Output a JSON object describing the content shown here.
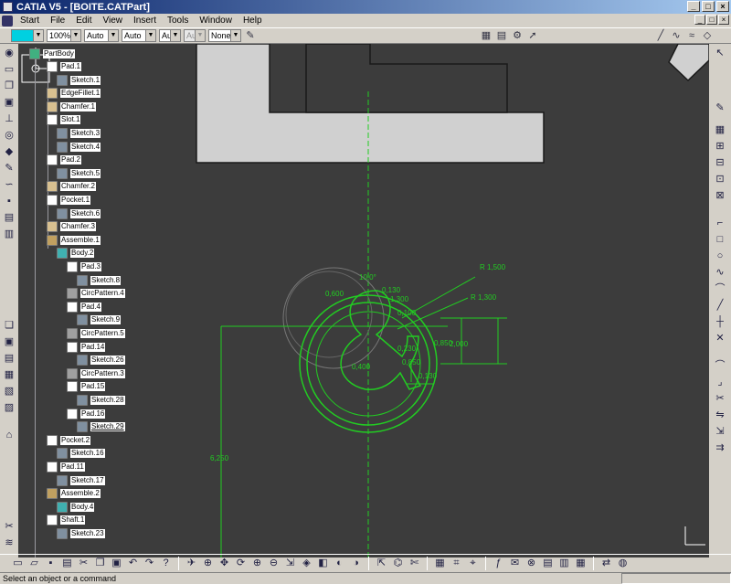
{
  "window": {
    "title": "CATIA V5 - [BOITE.CATPart]",
    "btn_min": "_",
    "btn_max": "□",
    "btn_close": "×"
  },
  "menu": {
    "items": [
      "Start",
      "File",
      "Edit",
      "View",
      "Insert",
      "Tools",
      "Window",
      "Help"
    ]
  },
  "toolbar": {
    "zoom_value": "100%",
    "line_combo_1": "Auto",
    "line_combo_2": "Auto",
    "line_combo_3": "Aut",
    "line_combo_4": "Aut",
    "layer_combo": "None"
  },
  "tree": {
    "root": "PartBody",
    "nodes": [
      {
        "label": "Pad.1",
        "level": 1,
        "icon": "pad-icon"
      },
      {
        "label": "Sketch.1",
        "level": 2,
        "icon": "sketch-icon"
      },
      {
        "label": "EdgeFillet.1",
        "level": 1,
        "icon": "fillet-icon"
      },
      {
        "label": "Chamfer.1",
        "level": 1,
        "icon": "chamfer-icon"
      },
      {
        "label": "Slot.1",
        "level": 1,
        "icon": "slot-icon"
      },
      {
        "label": "Sketch.3",
        "level": 2,
        "icon": "sketch-icon"
      },
      {
        "label": "Sketch.4",
        "level": 2,
        "icon": "sketch-icon"
      },
      {
        "label": "Pad.2",
        "level": 1,
        "icon": "pad-icon"
      },
      {
        "label": "Sketch.5",
        "level": 2,
        "icon": "sketch-icon"
      },
      {
        "label": "Chamfer.2",
        "level": 1,
        "icon": "chamfer-icon"
      },
      {
        "label": "Pocket.1",
        "level": 1,
        "icon": "pocket-icon"
      },
      {
        "label": "Sketch.6",
        "level": 2,
        "icon": "sketch-icon"
      },
      {
        "label": "Chamfer.3",
        "level": 1,
        "icon": "chamfer-icon"
      },
      {
        "label": "Assemble.1",
        "level": 1,
        "icon": "assemble-icon"
      },
      {
        "label": "Body.2",
        "level": 2,
        "icon": "body-icon"
      },
      {
        "label": "Pad.3",
        "level": 3,
        "icon": "pad-icon"
      },
      {
        "label": "Sketch.8",
        "level": 4,
        "icon": "sketch-icon"
      },
      {
        "label": "CircPattern.4",
        "level": 3,
        "icon": "pattern-icon"
      },
      {
        "label": "Pad.4",
        "level": 3,
        "icon": "pad-icon"
      },
      {
        "label": "Sketch.9",
        "level": 4,
        "icon": "sketch-icon"
      },
      {
        "label": "CircPattern.5",
        "level": 3,
        "icon": "pattern-icon"
      },
      {
        "label": "Pad.14",
        "level": 3,
        "icon": "pad-icon"
      },
      {
        "label": "Sketch.26",
        "level": 4,
        "icon": "sketch-icon"
      },
      {
        "label": "CircPattern.3",
        "level": 3,
        "icon": "pattern-icon"
      },
      {
        "label": "Pad.15",
        "level": 3,
        "icon": "pad-icon"
      },
      {
        "label": "Sketch.28",
        "level": 4,
        "icon": "sketch-icon"
      },
      {
        "label": "Pad.16",
        "level": 3,
        "icon": "pad-icon"
      },
      {
        "label": "Sketch.29",
        "level": 4,
        "icon": "sketch-icon",
        "selected": true
      },
      {
        "label": "Pocket.2",
        "level": 1,
        "icon": "pocket-icon"
      },
      {
        "label": "Sketch.16",
        "level": 2,
        "icon": "sketch-icon"
      },
      {
        "label": "Pad.11",
        "level": 1,
        "icon": "pad-icon"
      },
      {
        "label": "Sketch.17",
        "level": 2,
        "icon": "sketch-icon"
      },
      {
        "label": "Assemble.2",
        "level": 1,
        "icon": "assemble-icon"
      },
      {
        "label": "Body.4",
        "level": 2,
        "icon": "body-icon"
      },
      {
        "label": "Shaft.1",
        "level": 1,
        "icon": "shaft-icon"
      },
      {
        "label": "Sketch.23",
        "level": 2,
        "icon": "sketch-icon"
      }
    ]
  },
  "dimensions": {
    "r_outer": "R 1,500",
    "r_inner": "R 1,300",
    "d1": "0,850",
    "d2": "2,000",
    "d3": "6,250",
    "d4": "0,130",
    "d5": "1,300",
    "d6": "10,0°",
    "d7": "0,600",
    "d8": "0,130",
    "d9": "0,100",
    "d10": "0,230",
    "d11": "0,400",
    "d12": "0,850"
  },
  "status": {
    "field": "",
    "message": "Select an object or a command"
  },
  "colors": {
    "viewport_bg": "#3c3c3c",
    "sketch_green": "#22cc22",
    "part_gray": "#d0d0d0"
  }
}
